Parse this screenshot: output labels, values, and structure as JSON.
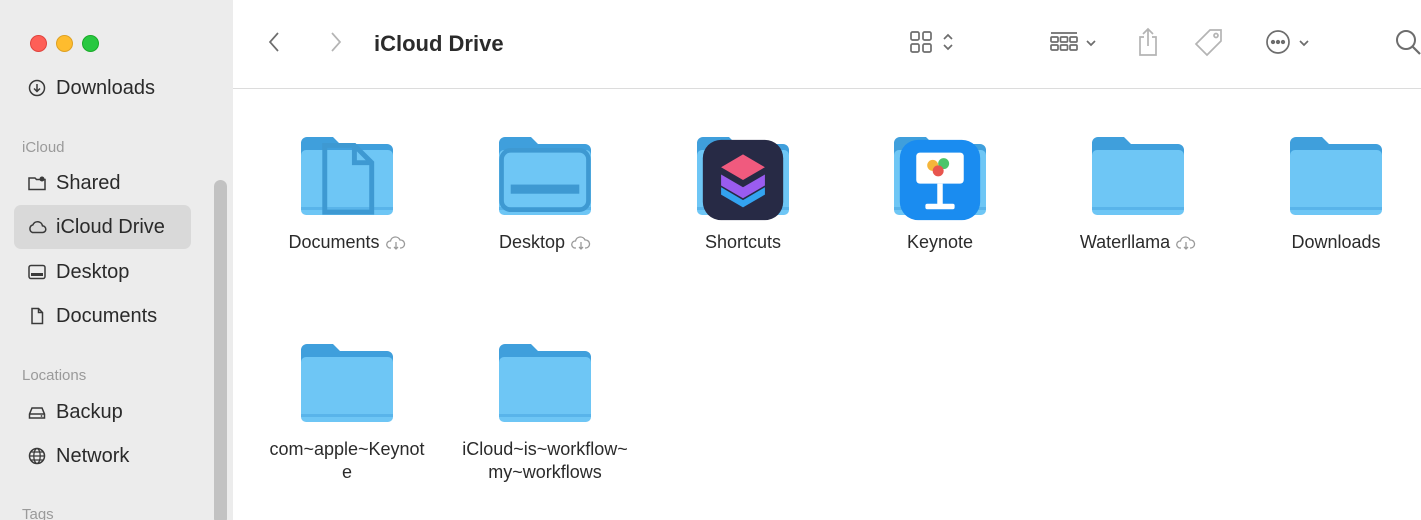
{
  "window": {
    "title": "iCloud Drive"
  },
  "sidebar": {
    "partial_item": "Downloads",
    "sections": [
      {
        "header": "iCloud",
        "items": [
          {
            "label": "Shared",
            "icon": "shared-folder-icon",
            "selected": false
          },
          {
            "label": "iCloud Drive",
            "icon": "cloud-icon",
            "selected": true
          },
          {
            "label": "Desktop",
            "icon": "desktop-icon",
            "selected": false
          },
          {
            "label": "Documents",
            "icon": "document-icon",
            "selected": false
          }
        ]
      },
      {
        "header": "Locations",
        "items": [
          {
            "label": "Backup",
            "icon": "drive-icon",
            "selected": false
          },
          {
            "label": "Network",
            "icon": "globe-icon",
            "selected": false
          }
        ]
      },
      {
        "header": "Tags",
        "items": []
      }
    ]
  },
  "toolbar": {
    "back": "chevron-left-icon",
    "forward": "chevron-right-icon",
    "view_mode": "icon-view-grid-icon",
    "group": "group-by-icon",
    "share": "share-icon",
    "tag": "tag-icon",
    "more": "ellipsis-circle-icon",
    "search": "search-icon"
  },
  "items": [
    {
      "name": "Documents",
      "cloud": true,
      "badge": "document"
    },
    {
      "name": "Desktop",
      "cloud": true,
      "badge": "desktop"
    },
    {
      "name": "Shortcuts",
      "cloud": false,
      "badge": "shortcuts-app"
    },
    {
      "name": "Keynote",
      "cloud": false,
      "badge": "keynote-app"
    },
    {
      "name": "Waterllama",
      "cloud": true,
      "badge": "none"
    },
    {
      "name": "Downloads",
      "cloud": false,
      "badge": "none"
    },
    {
      "name": "com~apple~Keynote",
      "cloud": false,
      "badge": "none"
    },
    {
      "name": "iCloud~is~workflow~my~workflows",
      "cloud": false,
      "badge": "none"
    }
  ],
  "colors": {
    "folder_body": "#6ec6f5",
    "folder_tab": "#4aa6e0",
    "sidebar_bg": "#ececec",
    "selection": "#d9d9d9"
  }
}
